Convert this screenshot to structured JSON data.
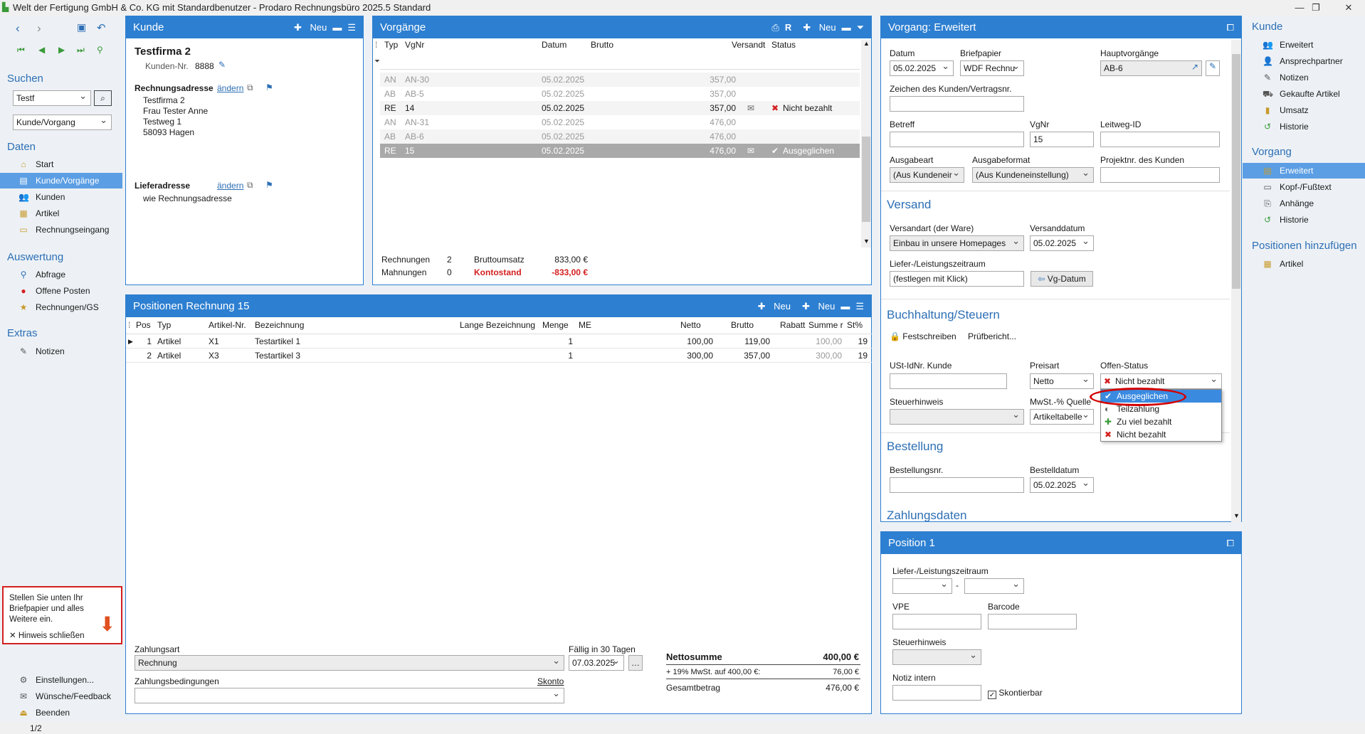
{
  "window": {
    "title": "Welt der Fertigung GmbH & Co. KG mit Standardbenutzer  -  Prodaro Rechnungsbüro 2025.5 Standard"
  },
  "nav": {
    "search_heading": "Suchen",
    "search_value": "Testf",
    "search_scope": "Kunde/Vorgang",
    "data_heading": "Daten",
    "data_items": [
      "Start",
      "Kunde/Vorgänge",
      "Kunden",
      "Artikel",
      "Rechnungseingang"
    ],
    "eval_heading": "Auswertung",
    "eval_items": [
      "Abfrage",
      "Offene Posten",
      "Rechnungen/GS"
    ],
    "extras_heading": "Extras",
    "extras_items": [
      "Notizen"
    ],
    "hint_text": "Stellen Sie unten Ihr Briefpapier und alles Weitere ein.",
    "hint_close": "Hinweis schließen",
    "bottom_items": [
      "Einstellungen...",
      "Wünsche/Feedback",
      "Beenden"
    ]
  },
  "customer": {
    "header": "Kunde",
    "new_label": "Neu",
    "name": "Testfirma 2",
    "nr_label": "Kunden-Nr.",
    "nr": "8888",
    "billing_label": "Rechnungsadresse",
    "change": "ändern",
    "billing_lines": [
      "Testfirma 2",
      "Frau Tester Anne",
      "Testweg 1",
      "58093 Hagen"
    ],
    "delivery_label": "Lieferadresse",
    "delivery_text": "wie Rechnungsadresse"
  },
  "vorgaenge": {
    "header": "Vorgänge",
    "new_label": "Neu",
    "columns": [
      "Typ",
      "VgNr",
      "Datum",
      "Brutto",
      "Versandt",
      "Status"
    ],
    "rows": [
      {
        "typ": "AN",
        "nr": "AN-30",
        "datum": "05.02.2025",
        "brutto": "357,00",
        "versandt": "",
        "status": ""
      },
      {
        "typ": "AB",
        "nr": "AB-5",
        "datum": "05.02.2025",
        "brutto": "357,00",
        "versandt": "",
        "status": ""
      },
      {
        "typ": "RE",
        "nr": "14",
        "datum": "05.02.2025",
        "brutto": "357,00",
        "versandt": "✉",
        "status": "Nicht bezahlt"
      },
      {
        "typ": "AN",
        "nr": "AN-31",
        "datum": "05.02.2025",
        "brutto": "476,00",
        "versandt": "",
        "status": ""
      },
      {
        "typ": "AB",
        "nr": "AB-6",
        "datum": "05.02.2025",
        "brutto": "476,00",
        "versandt": "",
        "status": ""
      },
      {
        "typ": "RE",
        "nr": "15",
        "datum": "05.02.2025",
        "brutto": "476,00",
        "versandt": "✉",
        "status": "Ausgeglichen"
      }
    ],
    "summary": {
      "rechnungen_label": "Rechnungen",
      "rechnungen": "2",
      "mahnungen_label": "Mahnungen",
      "mahnungen": "0",
      "umsatz_label": "Bruttoumsatz",
      "umsatz": "833,00 €",
      "konto_label": "Kontostand",
      "konto": "-833,00 €"
    }
  },
  "positions": {
    "header": "Positionen Rechnung 15",
    "new1": "Neu",
    "new2": "Neu",
    "columns": [
      "Pos",
      "Typ",
      "Artikel-Nr.",
      "Bezeichnung",
      "Lange Bezeichnung",
      "Menge",
      "ME",
      "Netto",
      "Brutto",
      "Rabatt",
      "Summe r",
      "St%"
    ],
    "rows": [
      {
        "pos": "1",
        "typ": "Artikel",
        "nr": "X1",
        "bez": "Testartikel 1",
        "menge": "1",
        "netto": "100,00",
        "brutto": "119,00",
        "summe": "100,00",
        "st": "19"
      },
      {
        "pos": "2",
        "typ": "Artikel",
        "nr": "X3",
        "bez": "Testartikel 3",
        "menge": "1",
        "netto": "300,00",
        "brutto": "357,00",
        "summe": "300,00",
        "st": "19"
      }
    ],
    "zahlungsart_label": "Zahlungsart",
    "zahlungsart": "Rechnung",
    "faellig_label": "Fällig in 30 Tagen",
    "faellig": "07.03.2025",
    "bedingungen_label": "Zahlungsbedingungen",
    "skonto": "Skonto",
    "netto_label": "Nettosumme",
    "netto": "400,00  €",
    "mwst_label": "+ 19% MwSt. auf 400,00 €:",
    "mwst": "76,00  €",
    "gesamt_label": "Gesamtbetrag",
    "gesamt": "476,00  €"
  },
  "erweitert": {
    "header": "Vorgang: Erweitert",
    "datum_label": "Datum",
    "datum": "05.02.2025",
    "brief_label": "Briefpapier",
    "brief": "WDF Rechnu",
    "haupt_label": "Hauptvorgänge",
    "haupt": "AB-6",
    "zeichen_label": "Zeichen des Kunden/Vertragsnr.",
    "betreff_label": "Betreff",
    "vgnr_label": "VgNr",
    "vgnr": "15",
    "leitweg_label": "Leitweg-ID",
    "ausgabeart_label": "Ausgabeart",
    "ausgabeart": "(Aus Kundeneir",
    "ausgabeformat_label": "Ausgabeformat",
    "ausgabeformat": "(Aus Kundeneinstellung)",
    "projekt_label": "Projektnr. des Kunden",
    "versand_heading": "Versand",
    "versandart_label": "Versandart (der Ware)",
    "versandart": "Einbau in unsere Homepages",
    "versanddatum_label": "Versanddatum",
    "versanddatum": "05.02.2025",
    "liefer_label": "Liefer-/Leistungszeitraum",
    "liefer": "(festlegen mit Klick)",
    "vgdatum_btn": "Vg-Datum",
    "buch_heading": "Buchhaltung/Steuern",
    "festschreiben": "Festschreiben",
    "pruef": "Prüfbericht...",
    "ust_label": "USt-IdNr. Kunde",
    "preisart_label": "Preisart",
    "preisart": "Netto",
    "offen_label": "Offen-Status",
    "offen": "Nicht bezahlt",
    "steuer_label": "Steuerhinweis",
    "mwstq_label": "MwSt.-% Quelle",
    "mwstq": "Artikeltabelle",
    "bestellung_heading": "Bestellung",
    "bestellnr_label": "Bestellungsnr.",
    "bestelldatum_label": "Bestelldatum",
    "bestelldatum": "05.02.2025",
    "zahlung_heading": "Zahlungsdaten",
    "dropdown": [
      "Ausgeglichen",
      "Teilzahlung",
      "Zu viel bezahlt",
      "Nicht bezahlt"
    ]
  },
  "position1": {
    "header": "Position 1",
    "liefer_label": "Liefer-/Leistungszeitraum",
    "vpe_label": "VPE",
    "barcode_label": "Barcode",
    "steuer_label": "Steuerhinweis",
    "notiz_label": "Notiz intern",
    "skontierbar": "Skontierbar"
  },
  "rightnav": {
    "kunde_heading": "Kunde",
    "kunde_items": [
      "Erweitert",
      "Ansprechpartner",
      "Notizen",
      "Gekaufte Artikel",
      "Umsatz",
      "Historie"
    ],
    "vorgang_heading": "Vorgang",
    "vorgang_items": [
      "Erweitert",
      "Kopf-/Fußtext",
      "Anhänge",
      "Historie"
    ],
    "pos_heading": "Positionen hinzufügen",
    "pos_items": [
      "Artikel"
    ]
  },
  "status": {
    "page": "1/2"
  },
  "colors": {
    "accent": "#2d7fd1",
    "selection": "#5b9ee4",
    "error": "#d42020",
    "success": "#3a9a3a"
  }
}
